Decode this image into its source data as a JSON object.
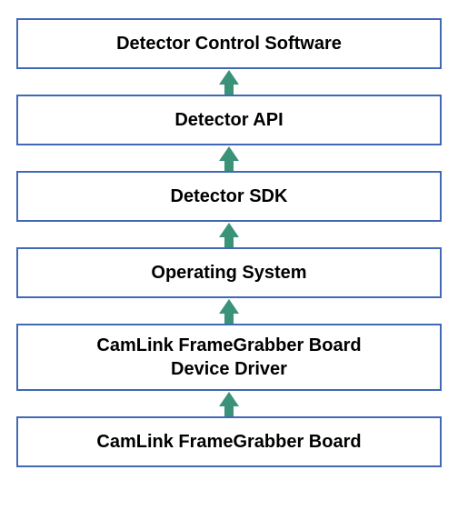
{
  "diagram": {
    "layers": [
      {
        "label": "Detector Control Software"
      },
      {
        "label": "Detector API"
      },
      {
        "label": "Detector SDK"
      },
      {
        "label": "Operating System"
      },
      {
        "label": "CamLink FrameGrabber Board\nDevice Driver"
      },
      {
        "label": "CamLink FrameGrabber Board"
      }
    ],
    "arrow_color": "#3a9278",
    "box_border_color": "#4169b5"
  }
}
